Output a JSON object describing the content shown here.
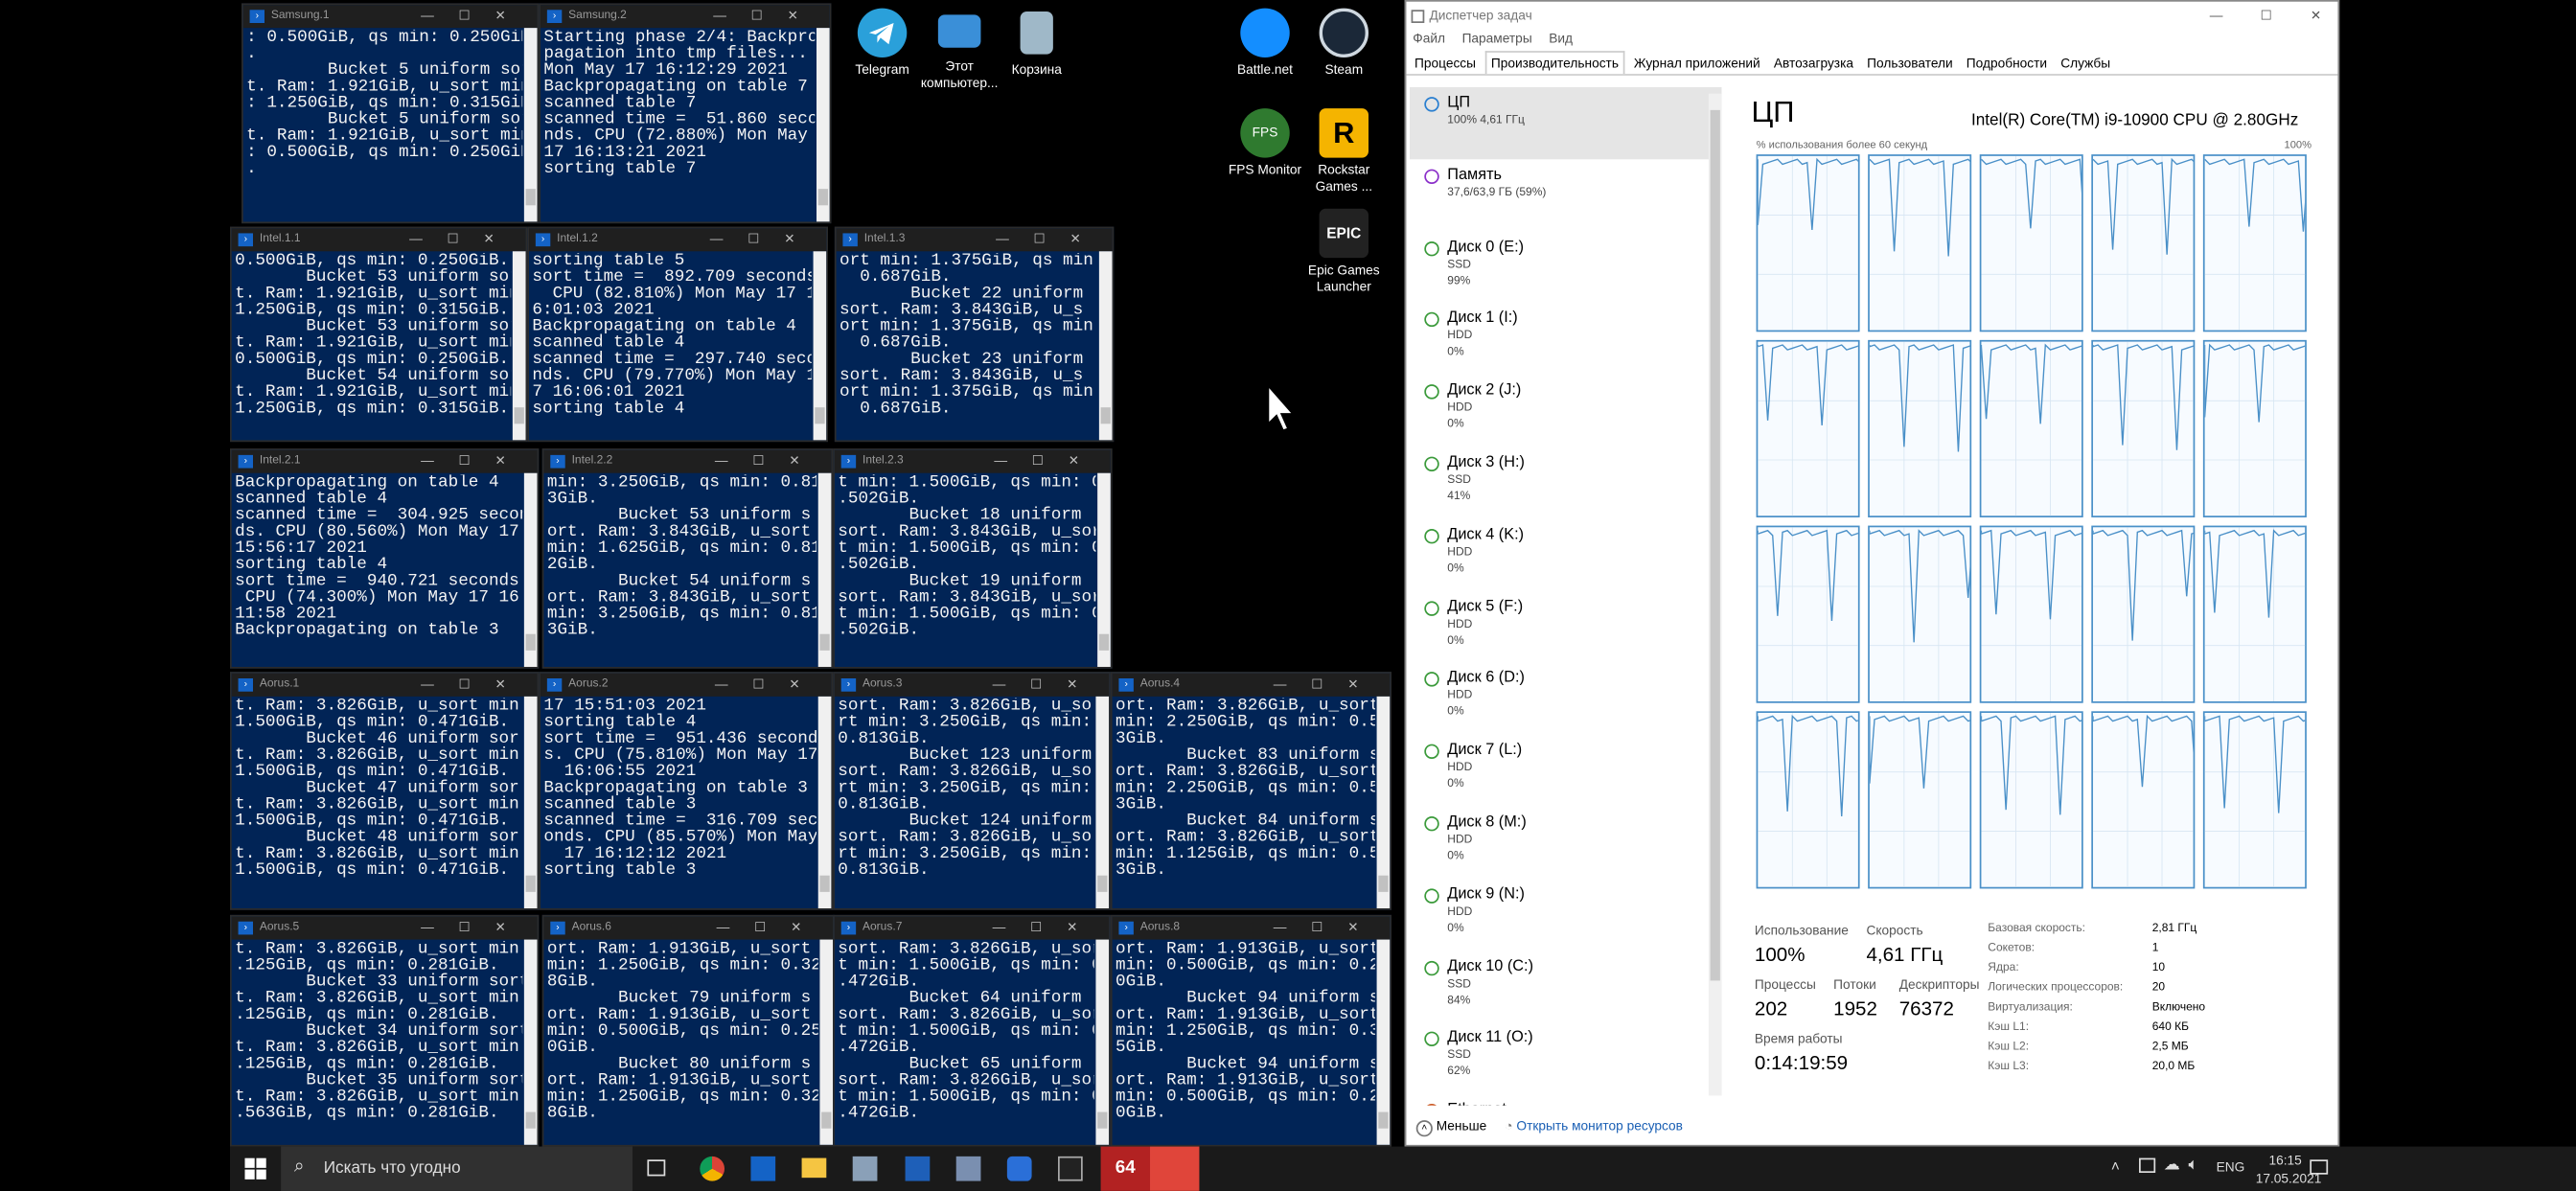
{
  "terminals": [
    {
      "title": "Samsung.1",
      "lines": [
        ": 0.500GiB, qs min: 0.250GiB",
        ".",
        "        Bucket 5 uniform sor",
        "t. Ram: 1.921GiB, u_sort min",
        ": 1.250GiB, qs min: 0.315GiB",
        "",
        "        Bucket 5 uniform sor",
        "t. Ram: 1.921GiB, u_sort min",
        ": 0.500GiB, qs min: 0.250GiB",
        "."
      ]
    },
    {
      "title": "Samsung.2",
      "lines": [
        "Starting phase 2/4: Backpro",
        "pagation into tmp files...",
        "Mon May 17 16:12:29 2021",
        "Backpropagating on table 7",
        "scanned table 7",
        "scanned time =  51.860 seco",
        "nds. CPU (72.880%) Mon May",
        "17 16:13:21 2021",
        "sorting table 7"
      ]
    },
    {
      "title": "Intel.1.1",
      "lines": [
        "0.500GiB, qs min: 0.250GiB.",
        "       Bucket 53 uniform sor",
        "t. Ram: 1.921GiB, u_sort min:",
        "1.250GiB, qs min: 0.315GiB.",
        "       Bucket 53 uniform sor",
        "t. Ram: 1.921GiB, u_sort min:",
        "0.500GiB, qs min: 0.250GiB.",
        "       Bucket 54 uniform sor",
        "t. Ram: 1.921GiB, u_sort min:",
        "1.250GiB, qs min: 0.315GiB."
      ]
    },
    {
      "title": "Intel.1.2",
      "lines": [
        "sorting table 5",
        "sort time =  892.709 seconds",
        "  CPU (82.810%) Mon May 17 1",
        "6:01:03 2021",
        "Backpropagating on table 4",
        "scanned table 4",
        "scanned time =  297.740 seco",
        "nds. CPU (79.770%) Mon May 1",
        "7 16:06:01 2021",
        "sorting table 4"
      ]
    },
    {
      "title": "Intel.1.3",
      "lines": [
        "ort min: 1.375GiB, qs min",
        "  0.687GiB.",
        "       Bucket 22 uniform",
        "sort. Ram: 3.843GiB, u_s",
        "ort min: 1.375GiB, qs min",
        "  0.687GiB.",
        "       Bucket 23 uniform",
        "sort. Ram: 3.843GiB, u_s",
        "ort min: 1.375GiB, qs min",
        "  0.687GiB."
      ]
    },
    {
      "title": "Intel.2.1",
      "lines": [
        "Backpropagating on table 4",
        "scanned table 4",
        "scanned time =  304.925 secon",
        "ds. CPU (80.560%) Mon May 17",
        "15:56:17 2021",
        "sorting table 4",
        "sort time =  940.721 seconds.",
        " CPU (74.300%) Mon May 17 16:",
        "11:58 2021",
        "Backpropagating on table 3"
      ]
    },
    {
      "title": "Intel.2.2",
      "lines": [
        "min: 3.250GiB, qs min: 0.81",
        "3GiB.",
        "       Bucket 53 uniform s",
        "ort. Ram: 3.843GiB, u_sort",
        "min: 1.625GiB, qs min: 0.81",
        "2GiB.",
        "       Bucket 54 uniform s",
        "ort. Ram: 3.843GiB, u_sort",
        "min: 3.250GiB, qs min: 0.81",
        "3GiB."
      ]
    },
    {
      "title": "Intel.2.3",
      "lines": [
        "t min: 1.500GiB, qs min: 0",
        ".502GiB.",
        "       Bucket 18 uniform",
        "sort. Ram: 3.843GiB, u_sor",
        "t min: 1.500GiB, qs min: 0",
        ".502GiB.",
        "       Bucket 19 uniform",
        "sort. Ram: 3.843GiB, u_sor",
        "t min: 1.500GiB, qs min: 0",
        ".502GiB."
      ]
    },
    {
      "title": "Aorus.1",
      "lines": [
        "t. Ram: 3.826GiB, u_sort min:",
        "1.500GiB, qs min: 0.471GiB.",
        "       Bucket 46 uniform sor",
        "t. Ram: 3.826GiB, u_sort min:",
        "1.500GiB, qs min: 0.471GiB.",
        "       Bucket 47 uniform sor",
        "t. Ram: 3.826GiB, u_sort min:",
        "1.500GiB, qs min: 0.471GiB.",
        "       Bucket 48 uniform sor",
        "t. Ram: 3.826GiB, u_sort min:",
        "1.500GiB, qs min: 0.471GiB."
      ]
    },
    {
      "title": "Aorus.2",
      "lines": [
        "17 15:51:03 2021",
        "sorting table 4",
        "sort time =  951.436 second",
        "s. CPU (75.810%) Mon May 17",
        "  16:06:55 2021",
        "Backpropagating on table 3",
        "scanned table 3",
        "scanned time =  316.709 sec",
        "onds. CPU (85.570%) Mon May",
        "  17 16:12:12 2021",
        "sorting table 3"
      ]
    },
    {
      "title": "Aorus.3",
      "lines": [
        "sort. Ram: 3.826GiB, u_so",
        "rt min: 3.250GiB, qs min:",
        "0.813GiB.",
        "       Bucket 123 uniform",
        "sort. Ram: 3.826GiB, u_so",
        "rt min: 3.250GiB, qs min:",
        "0.813GiB.",
        "       Bucket 124 uniform",
        "sort. Ram: 3.826GiB, u_so",
        "rt min: 3.250GiB, qs min:",
        "0.813GiB."
      ]
    },
    {
      "title": "Aorus.4",
      "lines": [
        "ort. Ram: 3.826GiB, u_sort",
        "min: 2.250GiB, qs min: 0.56",
        "3GiB.",
        "       Bucket 83 uniform s",
        "ort. Ram: 3.826GiB, u_sort",
        "min: 2.250GiB, qs min: 0.56",
        "3GiB.",
        "       Bucket 84 uniform s",
        "ort. Ram: 3.826GiB, u_sort",
        "min: 1.125GiB, qs min: 0.56",
        "3GiB."
      ]
    },
    {
      "title": "Aorus.5",
      "lines": [
        "t. Ram: 3.826GiB, u_sort min: 1",
        ".125GiB, qs min: 0.281GiB.",
        "       Bucket 33 uniform sort",
        "t. Ram: 3.826GiB, u_sort min: 1",
        ".125GiB, qs min: 0.281GiB.",
        "       Bucket 34 uniform sort",
        "t. Ram: 3.826GiB, u_sort min: 1",
        ".125GiB, qs min: 0.281GiB.",
        "       Bucket 35 uniform sort",
        "t. Ram: 3.826GiB, u_sort min: 0",
        ".563GiB, qs min: 0.281GiB."
      ]
    },
    {
      "title": "Aorus.6",
      "lines": [
        "ort. Ram: 1.913GiB, u_sort",
        "min: 1.250GiB, qs min: 0.32",
        "8GiB.",
        "       Bucket 79 uniform s",
        "ort. Ram: 1.913GiB, u_sort",
        "min: 0.500GiB, qs min: 0.25",
        "0GiB.",
        "       Bucket 80 uniform s",
        "ort. Ram: 1.913GiB, u_sort",
        "min: 1.250GiB, qs min: 0.32",
        "8GiB."
      ]
    },
    {
      "title": "Aorus.7",
      "lines": [
        "sort. Ram: 3.826GiB, u_sor",
        "t min: 1.500GiB, qs min: 0",
        ".472GiB.",
        "       Bucket 64 uniform",
        "sort. Ram: 3.826GiB, u_sor",
        "t min: 1.500GiB, qs min: 0",
        ".472GiB.",
        "       Bucket 65 uniform",
        "sort. Ram: 3.826GiB, u_sor",
        "t min: 1.500GiB, qs min: 0",
        ".472GiB."
      ]
    },
    {
      "title": "Aorus.8",
      "lines": [
        "ort. Ram: 1.913GiB, u_sort",
        "min: 0.500GiB, qs min: 0.25",
        "0GiB.",
        "       Bucket 94 uniform s",
        "ort. Ram: 1.913GiB, u_sort",
        "min: 1.250GiB, qs min: 0.31",
        "5GiB.",
        "       Bucket 94 uniform s",
        "ort. Ram: 1.913GiB, u_sort",
        "min: 0.500GiB, qs min: 0.25",
        "0GiB."
      ]
    }
  ],
  "desktop_icons": [
    {
      "label": "Telegram",
      "icon": "telegram-icon",
      "color": "#2aa0da"
    },
    {
      "label": "Этот компьютер...",
      "icon": "computer-icon",
      "color": "#3a8fd8"
    },
    {
      "label": "Корзина",
      "icon": "recycle-bin-icon",
      "color": "#9fb8c8"
    },
    {
      "label": "Battle.net",
      "icon": "battlenet-icon",
      "color": "#148eff"
    },
    {
      "label": "Steam",
      "icon": "steam-icon",
      "color": "#1b2838"
    },
    {
      "label": "FPS Monitor",
      "icon": "fps-monitor-icon",
      "color": "#2f7a2f"
    },
    {
      "label": "Rockstar Games ...",
      "icon": "rockstar-icon",
      "color": "#f5b400"
    },
    {
      "label": "Epic Games Launcher",
      "icon": "epic-games-icon",
      "color": "#222222"
    }
  ],
  "taskmgr": {
    "title": "Диспетчер задач",
    "menu": [
      "Файл",
      "Параметры",
      "Вид"
    ],
    "tabs": [
      "Процессы",
      "Производительность",
      "Журнал приложений",
      "Автозагрузка",
      "Пользователи",
      "Подробности",
      "Службы"
    ],
    "resources": [
      {
        "name": "ЦП",
        "s1": "100%  4,61 ГГц",
        "s2": ""
      },
      {
        "name": "Память",
        "s1": "37,6/63,9 ГБ (59%)",
        "s2": ""
      },
      {
        "name": "Диск 0 (E:)",
        "s1": "SSD",
        "s2": "99%"
      },
      {
        "name": "Диск 1 (I:)",
        "s1": "HDD",
        "s2": "0%"
      },
      {
        "name": "Диск 2 (J:)",
        "s1": "HDD",
        "s2": "0%"
      },
      {
        "name": "Диск 3 (H:)",
        "s1": "SSD",
        "s2": "41%"
      },
      {
        "name": "Диск 4 (K:)",
        "s1": "HDD",
        "s2": "0%"
      },
      {
        "name": "Диск 5 (F:)",
        "s1": "HDD",
        "s2": "0%"
      },
      {
        "name": "Диск 6 (D:)",
        "s1": "HDD",
        "s2": "0%"
      },
      {
        "name": "Диск 7 (L:)",
        "s1": "HDD",
        "s2": "0%"
      },
      {
        "name": "Диск 8 (M:)",
        "s1": "HDD",
        "s2": "0%"
      },
      {
        "name": "Диск 9 (N:)",
        "s1": "HDD",
        "s2": "0%"
      },
      {
        "name": "Диск 10 (C:)",
        "s1": "SSD",
        "s2": "84%"
      },
      {
        "name": "Диск 11 (O:)",
        "s1": "SSD",
        "s2": "62%"
      },
      {
        "name": "Ethernet",
        "s1": "",
        "s2": ""
      }
    ],
    "cpu_heading": "ЦП",
    "cpu_model": "Intel(R) Core(TM) i9-10900 CPU @ 2.80GHz",
    "graph_caption": "% использования более 60 секунд",
    "graph_max": "100%",
    "usage_label": "Использование",
    "usage_value": "100%",
    "speed_label": "Скорость",
    "speed_value": "4,61 ГГц",
    "proc_label": "Процессы",
    "proc_value": "202",
    "threads_label": "Потоки",
    "threads_value": "1952",
    "handles_label": "Дескрипторы",
    "handles_value": "76372",
    "uptime_label": "Время работы",
    "uptime_value": "0:14:19:59",
    "details": [
      {
        "k": "Базовая скорость:",
        "v": "2,81 ГГц"
      },
      {
        "k": "Сокетов:",
        "v": "1"
      },
      {
        "k": "Ядра:",
        "v": "10"
      },
      {
        "k": "Логических процессоров:",
        "v": "20"
      },
      {
        "k": "Виртуализация:",
        "v": "Включено"
      },
      {
        "k": "Кэш L1:",
        "v": "640 КБ"
      },
      {
        "k": "Кэш L2:",
        "v": "2,5 МБ"
      },
      {
        "k": "Кэш L3:",
        "v": "20,0 МБ"
      }
    ],
    "less_label": "Меньше",
    "open_monitor": "Открыть монитор ресурсов"
  },
  "taskbar": {
    "search_placeholder": "Искать что угодно",
    "lang": "ENG",
    "time": "16:15",
    "date": "17.05.2021",
    "app_badge": "64"
  }
}
